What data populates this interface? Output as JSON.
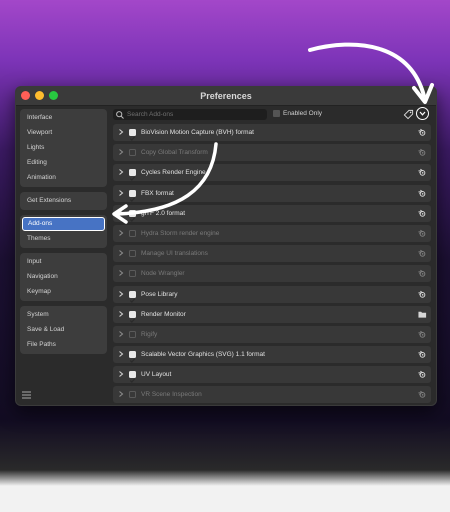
{
  "window": {
    "title": "Preferences"
  },
  "sidebar": {
    "groups": [
      [
        "Interface",
        "Viewport",
        "Lights",
        "Editing",
        "Animation"
      ],
      [
        "Get Extensions"
      ],
      [
        "Add-ons",
        "Themes"
      ],
      [
        "Input",
        "Navigation",
        "Keymap"
      ],
      [
        "System",
        "Save & Load",
        "File Paths"
      ]
    ],
    "active": "Add-ons"
  },
  "search": {
    "placeholder": "Search Add-ons"
  },
  "filter": {
    "enabled_only_label": "Enabled Only"
  },
  "addons": [
    {
      "name": "BioVision Motion Capture (BVH) format",
      "enabled": true,
      "icon": "blender-icon"
    },
    {
      "name": "Copy Global Transform",
      "enabled": false,
      "icon": "blender-icon"
    },
    {
      "name": "Cycles Render Engine",
      "enabled": true,
      "icon": "blender-icon"
    },
    {
      "name": "FBX format",
      "enabled": true,
      "icon": "blender-icon"
    },
    {
      "name": "glTF 2.0 format",
      "enabled": true,
      "icon": "blender-icon"
    },
    {
      "name": "Hydra Storm render engine",
      "enabled": false,
      "icon": "blender-icon"
    },
    {
      "name": "Manage UI translations",
      "enabled": false,
      "icon": "blender-icon"
    },
    {
      "name": "Node Wrangler",
      "enabled": false,
      "icon": "blender-icon"
    },
    {
      "name": "Pose Library",
      "enabled": true,
      "icon": "blender-icon"
    },
    {
      "name": "Render Monitor",
      "enabled": true,
      "icon": "folder-icon"
    },
    {
      "name": "Rigify",
      "enabled": false,
      "icon": "blender-icon"
    },
    {
      "name": "Scalable Vector Graphics (SVG) 1.1 format",
      "enabled": true,
      "icon": "blender-icon"
    },
    {
      "name": "UV Layout",
      "enabled": true,
      "icon": "blender-icon"
    },
    {
      "name": "VR Scene Inspection",
      "enabled": false,
      "icon": "blender-icon"
    }
  ],
  "colors": {
    "accent": "#4773c4",
    "background_top": "#a347c9",
    "window": "#2b2b2b"
  }
}
